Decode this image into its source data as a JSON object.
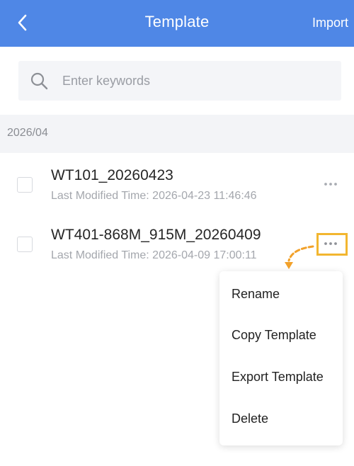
{
  "header": {
    "title": "Template",
    "import_label": "Import"
  },
  "search": {
    "placeholder": "Enter keywords"
  },
  "group": {
    "label": "2026/04"
  },
  "templates": [
    {
      "name": "WT101_20260423",
      "modified": "Last Modified Time: 2026-04-23 11:46:46"
    },
    {
      "name": "WT401-868M_915M_20260409",
      "modified": "Last Modified Time: 2026-04-09 17:00:11"
    }
  ],
  "menu": {
    "items": [
      "Rename",
      "Copy Template",
      "Export Template",
      "Delete"
    ]
  },
  "icons": {
    "back": "chevron-left-icon",
    "search": "search-icon",
    "more": "more-horizontal-icon",
    "annotation": "dashed-arrow-icon"
  },
  "colors": {
    "header": "#4f87e6",
    "highlight": "#f2b630",
    "annotation_arrow": "#f2a12a"
  }
}
